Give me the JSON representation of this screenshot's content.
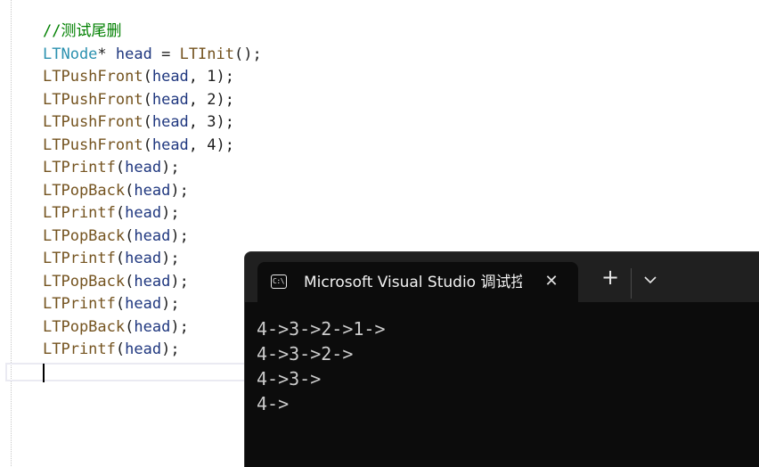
{
  "editor": {
    "lines": [
      [
        {
          "t": "//测试尾删",
          "c": "comment"
        }
      ],
      [
        {
          "t": "LTNode",
          "c": "type"
        },
        {
          "t": "* ",
          "c": "punct"
        },
        {
          "t": "head",
          "c": "var"
        },
        {
          "t": " = ",
          "c": "punct"
        },
        {
          "t": "LTInit",
          "c": "func"
        },
        {
          "t": "();",
          "c": "punct"
        }
      ],
      [
        {
          "t": "LTPushFront",
          "c": "func"
        },
        {
          "t": "(",
          "c": "punct"
        },
        {
          "t": "head",
          "c": "var"
        },
        {
          "t": ", 1);",
          "c": "punct"
        }
      ],
      [
        {
          "t": "LTPushFront",
          "c": "func"
        },
        {
          "t": "(",
          "c": "punct"
        },
        {
          "t": "head",
          "c": "var"
        },
        {
          "t": ", 2);",
          "c": "punct"
        }
      ],
      [
        {
          "t": "LTPushFront",
          "c": "func"
        },
        {
          "t": "(",
          "c": "punct"
        },
        {
          "t": "head",
          "c": "var"
        },
        {
          "t": ", 3);",
          "c": "punct"
        }
      ],
      [
        {
          "t": "LTPushFront",
          "c": "func"
        },
        {
          "t": "(",
          "c": "punct"
        },
        {
          "t": "head",
          "c": "var"
        },
        {
          "t": ", 4);",
          "c": "punct"
        }
      ],
      [
        {
          "t": "LTPrintf",
          "c": "func"
        },
        {
          "t": "(",
          "c": "punct"
        },
        {
          "t": "head",
          "c": "var"
        },
        {
          "t": ");",
          "c": "punct"
        }
      ],
      [
        {
          "t": "LTPopBack",
          "c": "func"
        },
        {
          "t": "(",
          "c": "punct"
        },
        {
          "t": "head",
          "c": "var"
        },
        {
          "t": ");",
          "c": "punct"
        }
      ],
      [
        {
          "t": "LTPrintf",
          "c": "func"
        },
        {
          "t": "(",
          "c": "punct"
        },
        {
          "t": "head",
          "c": "var"
        },
        {
          "t": ");",
          "c": "punct"
        }
      ],
      [
        {
          "t": "LTPopBack",
          "c": "func"
        },
        {
          "t": "(",
          "c": "punct"
        },
        {
          "t": "head",
          "c": "var"
        },
        {
          "t": ");",
          "c": "punct"
        }
      ],
      [
        {
          "t": "LTPrintf",
          "c": "func"
        },
        {
          "t": "(",
          "c": "punct"
        },
        {
          "t": "head",
          "c": "var"
        },
        {
          "t": ");",
          "c": "punct"
        }
      ],
      [
        {
          "t": "LTPopBack",
          "c": "func"
        },
        {
          "t": "(",
          "c": "punct"
        },
        {
          "t": "head",
          "c": "var"
        },
        {
          "t": ");",
          "c": "punct"
        }
      ],
      [
        {
          "t": "LTPrintf",
          "c": "func"
        },
        {
          "t": "(",
          "c": "punct"
        },
        {
          "t": "head",
          "c": "var"
        },
        {
          "t": ");",
          "c": "punct"
        }
      ],
      [
        {
          "t": "LTPopBack",
          "c": "func"
        },
        {
          "t": "(",
          "c": "punct"
        },
        {
          "t": "head",
          "c": "var"
        },
        {
          "t": ");",
          "c": "punct"
        }
      ],
      [
        {
          "t": "LTPrintf",
          "c": "func"
        },
        {
          "t": "(",
          "c": "punct"
        },
        {
          "t": "head",
          "c": "var"
        },
        {
          "t": ");",
          "c": "punct"
        }
      ]
    ]
  },
  "terminal": {
    "tab_title": "Microsoft Visual Studio 调试控",
    "tab_icon": "terminal-icon",
    "close_glyph": "✕",
    "new_tab_glyph": "+",
    "dropdown_icon": "chevron-down-icon",
    "output": [
      "4->3->2->1->",
      "4->3->2->",
      "4->3->",
      "4->"
    ]
  },
  "colors": {
    "comment": "#008000",
    "type": "#2b91af",
    "func": "#74531f",
    "var": "#1f377f",
    "terminal_bg": "#0c0c0c",
    "terminal_fg": "#cccccc",
    "tab_strip_bg": "#202020"
  }
}
